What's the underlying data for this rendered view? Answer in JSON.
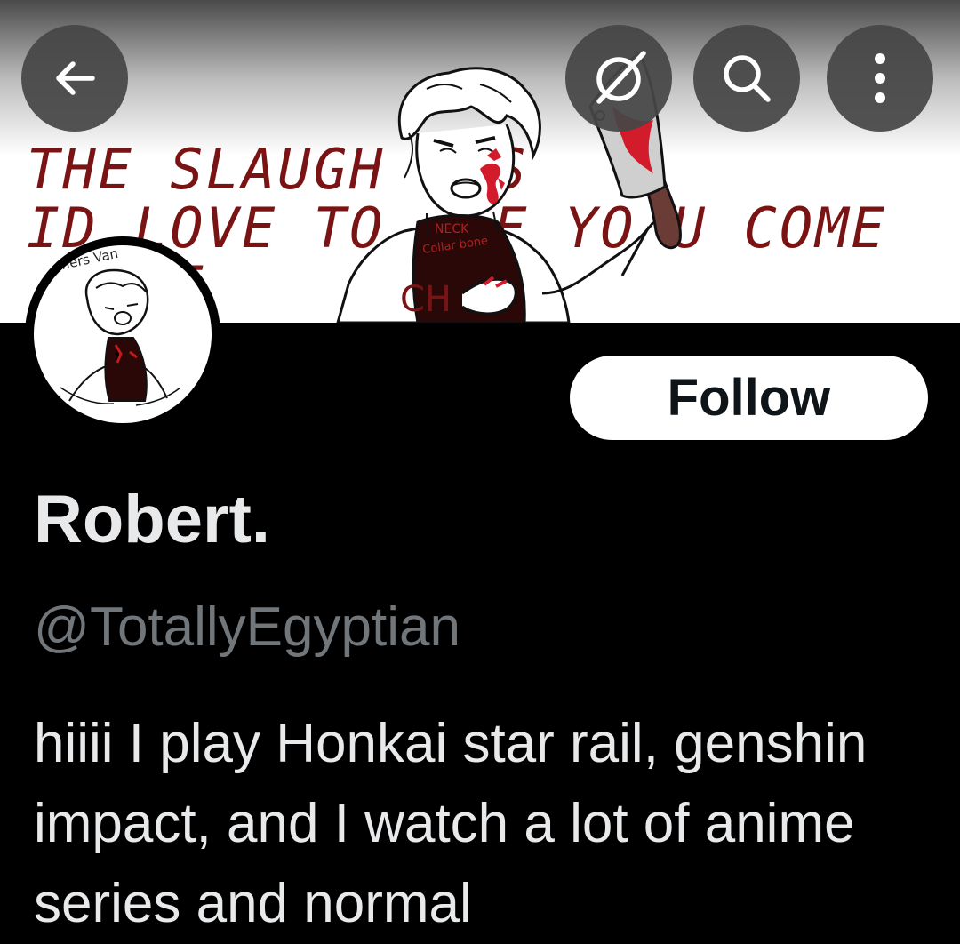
{
  "header": {
    "back_icon": "arrow-left-icon",
    "grok_icon": "slashed-circle-icon",
    "search_icon": "search-icon",
    "more_icon": "more-vertical-icon"
  },
  "banner": {
    "lines": [
      "THE SLAUGH   S   ,",
      "ID LOVE TO  EF YO U COME",
      "    E"
    ],
    "text_color": "#7a1414",
    "art_labels": [
      "rchers Van",
      "NECK",
      "Collar bone",
      "CH"
    ]
  },
  "profile": {
    "follow_label": "Follow",
    "display_name": "Robert.",
    "handle": "@TotallyEgyptian",
    "bio": "hiiii  I play Honkai star rail, genshin impact, and I watch a lot of anime series and normal"
  },
  "colors": {
    "background": "#000000",
    "text_primary": "#e7e9ea",
    "text_secondary": "#71767b",
    "follow_bg": "#ffffff",
    "icon_button_bg": "#464646"
  }
}
